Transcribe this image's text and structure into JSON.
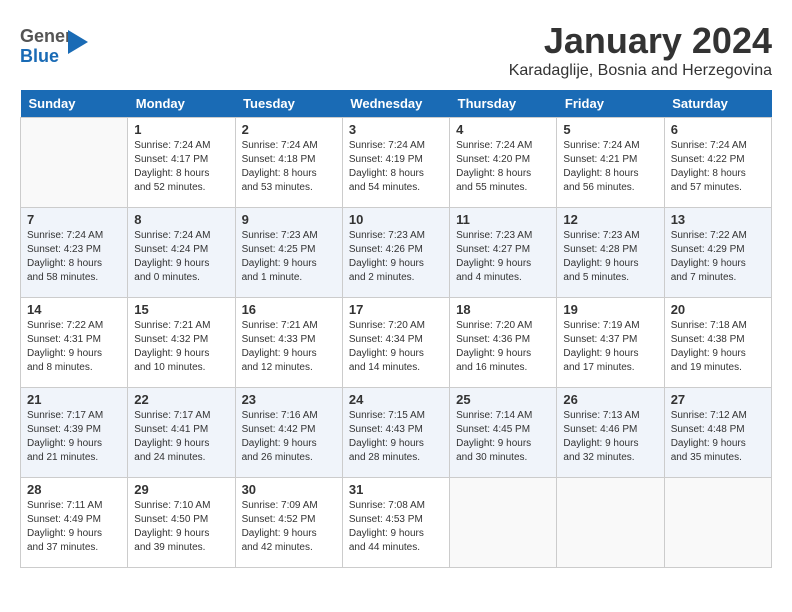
{
  "header": {
    "logo_general": "General",
    "logo_blue": "Blue",
    "month_title": "January 2024",
    "location": "Karadaglije, Bosnia and Herzegovina"
  },
  "weekdays": [
    "Sunday",
    "Monday",
    "Tuesday",
    "Wednesday",
    "Thursday",
    "Friday",
    "Saturday"
  ],
  "weeks": [
    [
      {
        "day": "",
        "sunrise": "",
        "sunset": "",
        "daylight": ""
      },
      {
        "day": "1",
        "sunrise": "Sunrise: 7:24 AM",
        "sunset": "Sunset: 4:17 PM",
        "daylight": "Daylight: 8 hours and 52 minutes."
      },
      {
        "day": "2",
        "sunrise": "Sunrise: 7:24 AM",
        "sunset": "Sunset: 4:18 PM",
        "daylight": "Daylight: 8 hours and 53 minutes."
      },
      {
        "day": "3",
        "sunrise": "Sunrise: 7:24 AM",
        "sunset": "Sunset: 4:19 PM",
        "daylight": "Daylight: 8 hours and 54 minutes."
      },
      {
        "day": "4",
        "sunrise": "Sunrise: 7:24 AM",
        "sunset": "Sunset: 4:20 PM",
        "daylight": "Daylight: 8 hours and 55 minutes."
      },
      {
        "day": "5",
        "sunrise": "Sunrise: 7:24 AM",
        "sunset": "Sunset: 4:21 PM",
        "daylight": "Daylight: 8 hours and 56 minutes."
      },
      {
        "day": "6",
        "sunrise": "Sunrise: 7:24 AM",
        "sunset": "Sunset: 4:22 PM",
        "daylight": "Daylight: 8 hours and 57 minutes."
      }
    ],
    [
      {
        "day": "7",
        "sunrise": "Sunrise: 7:24 AM",
        "sunset": "Sunset: 4:23 PM",
        "daylight": "Daylight: 8 hours and 58 minutes."
      },
      {
        "day": "8",
        "sunrise": "Sunrise: 7:24 AM",
        "sunset": "Sunset: 4:24 PM",
        "daylight": "Daylight: 9 hours and 0 minutes."
      },
      {
        "day": "9",
        "sunrise": "Sunrise: 7:23 AM",
        "sunset": "Sunset: 4:25 PM",
        "daylight": "Daylight: 9 hours and 1 minute."
      },
      {
        "day": "10",
        "sunrise": "Sunrise: 7:23 AM",
        "sunset": "Sunset: 4:26 PM",
        "daylight": "Daylight: 9 hours and 2 minutes."
      },
      {
        "day": "11",
        "sunrise": "Sunrise: 7:23 AM",
        "sunset": "Sunset: 4:27 PM",
        "daylight": "Daylight: 9 hours and 4 minutes."
      },
      {
        "day": "12",
        "sunrise": "Sunrise: 7:23 AM",
        "sunset": "Sunset: 4:28 PM",
        "daylight": "Daylight: 9 hours and 5 minutes."
      },
      {
        "day": "13",
        "sunrise": "Sunrise: 7:22 AM",
        "sunset": "Sunset: 4:29 PM",
        "daylight": "Daylight: 9 hours and 7 minutes."
      }
    ],
    [
      {
        "day": "14",
        "sunrise": "Sunrise: 7:22 AM",
        "sunset": "Sunset: 4:31 PM",
        "daylight": "Daylight: 9 hours and 8 minutes."
      },
      {
        "day": "15",
        "sunrise": "Sunrise: 7:21 AM",
        "sunset": "Sunset: 4:32 PM",
        "daylight": "Daylight: 9 hours and 10 minutes."
      },
      {
        "day": "16",
        "sunrise": "Sunrise: 7:21 AM",
        "sunset": "Sunset: 4:33 PM",
        "daylight": "Daylight: 9 hours and 12 minutes."
      },
      {
        "day": "17",
        "sunrise": "Sunrise: 7:20 AM",
        "sunset": "Sunset: 4:34 PM",
        "daylight": "Daylight: 9 hours and 14 minutes."
      },
      {
        "day": "18",
        "sunrise": "Sunrise: 7:20 AM",
        "sunset": "Sunset: 4:36 PM",
        "daylight": "Daylight: 9 hours and 16 minutes."
      },
      {
        "day": "19",
        "sunrise": "Sunrise: 7:19 AM",
        "sunset": "Sunset: 4:37 PM",
        "daylight": "Daylight: 9 hours and 17 minutes."
      },
      {
        "day": "20",
        "sunrise": "Sunrise: 7:18 AM",
        "sunset": "Sunset: 4:38 PM",
        "daylight": "Daylight: 9 hours and 19 minutes."
      }
    ],
    [
      {
        "day": "21",
        "sunrise": "Sunrise: 7:17 AM",
        "sunset": "Sunset: 4:39 PM",
        "daylight": "Daylight: 9 hours and 21 minutes."
      },
      {
        "day": "22",
        "sunrise": "Sunrise: 7:17 AM",
        "sunset": "Sunset: 4:41 PM",
        "daylight": "Daylight: 9 hours and 24 minutes."
      },
      {
        "day": "23",
        "sunrise": "Sunrise: 7:16 AM",
        "sunset": "Sunset: 4:42 PM",
        "daylight": "Daylight: 9 hours and 26 minutes."
      },
      {
        "day": "24",
        "sunrise": "Sunrise: 7:15 AM",
        "sunset": "Sunset: 4:43 PM",
        "daylight": "Daylight: 9 hours and 28 minutes."
      },
      {
        "day": "25",
        "sunrise": "Sunrise: 7:14 AM",
        "sunset": "Sunset: 4:45 PM",
        "daylight": "Daylight: 9 hours and 30 minutes."
      },
      {
        "day": "26",
        "sunrise": "Sunrise: 7:13 AM",
        "sunset": "Sunset: 4:46 PM",
        "daylight": "Daylight: 9 hours and 32 minutes."
      },
      {
        "day": "27",
        "sunrise": "Sunrise: 7:12 AM",
        "sunset": "Sunset: 4:48 PM",
        "daylight": "Daylight: 9 hours and 35 minutes."
      }
    ],
    [
      {
        "day": "28",
        "sunrise": "Sunrise: 7:11 AM",
        "sunset": "Sunset: 4:49 PM",
        "daylight": "Daylight: 9 hours and 37 minutes."
      },
      {
        "day": "29",
        "sunrise": "Sunrise: 7:10 AM",
        "sunset": "Sunset: 4:50 PM",
        "daylight": "Daylight: 9 hours and 39 minutes."
      },
      {
        "day": "30",
        "sunrise": "Sunrise: 7:09 AM",
        "sunset": "Sunset: 4:52 PM",
        "daylight": "Daylight: 9 hours and 42 minutes."
      },
      {
        "day": "31",
        "sunrise": "Sunrise: 7:08 AM",
        "sunset": "Sunset: 4:53 PM",
        "daylight": "Daylight: 9 hours and 44 minutes."
      },
      {
        "day": "",
        "sunrise": "",
        "sunset": "",
        "daylight": ""
      },
      {
        "day": "",
        "sunrise": "",
        "sunset": "",
        "daylight": ""
      },
      {
        "day": "",
        "sunrise": "",
        "sunset": "",
        "daylight": ""
      }
    ]
  ]
}
